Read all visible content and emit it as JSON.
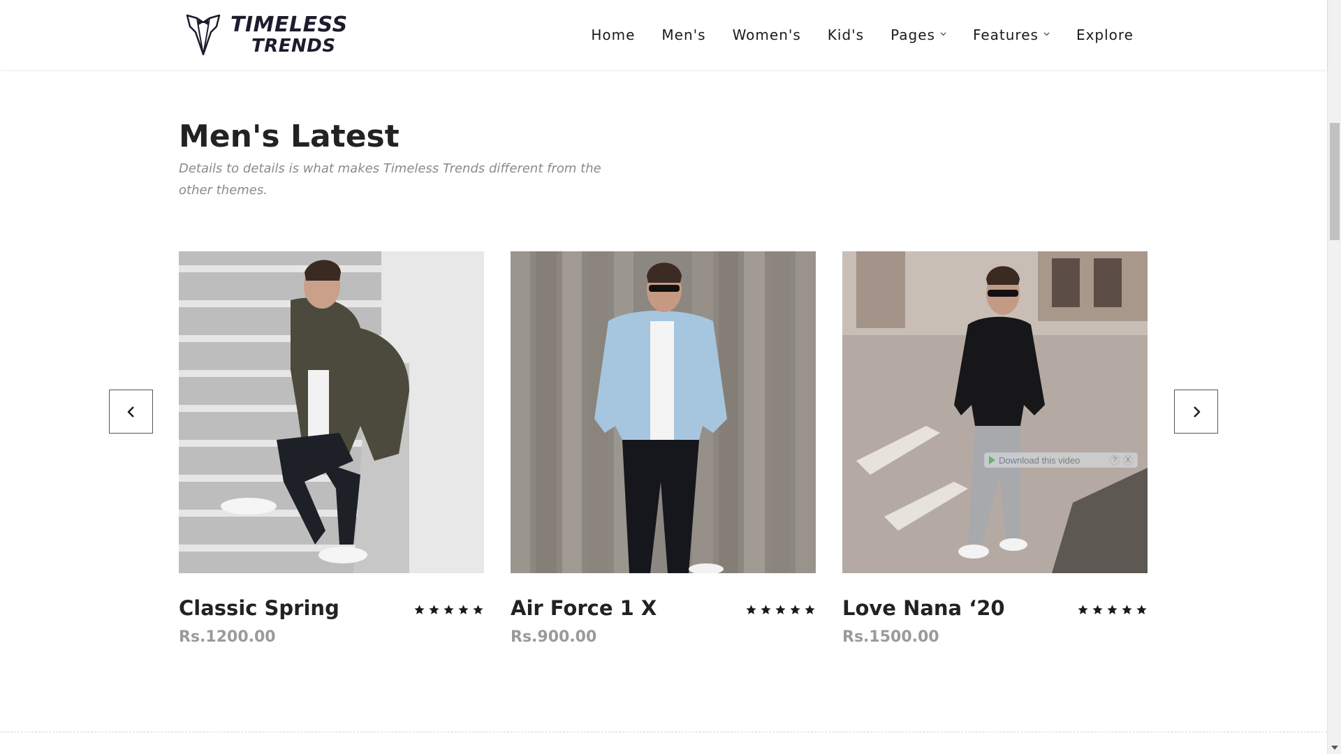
{
  "brand": {
    "line1": "TIMELESS",
    "line2": "TRENDS"
  },
  "nav": {
    "items": [
      {
        "label": "Home",
        "dropdown": false
      },
      {
        "label": "Men's",
        "dropdown": false
      },
      {
        "label": "Women's",
        "dropdown": false
      },
      {
        "label": "Kid's",
        "dropdown": false
      },
      {
        "label": "Pages",
        "dropdown": true
      },
      {
        "label": "Features",
        "dropdown": true
      },
      {
        "label": "Explore",
        "dropdown": false
      }
    ]
  },
  "section": {
    "title": "Men's Latest",
    "subtitle": "Details to details is what makes Timeless Trends different from the other themes."
  },
  "carousel": {
    "prev_icon": "chevron-left-icon",
    "next_icon": "chevron-right-icon"
  },
  "products": [
    {
      "name": "Classic Spring",
      "price": "Rs.1200.00",
      "rating": 5,
      "image": "man-on-stairs-camo-jacket"
    },
    {
      "name": "Air Force 1 X",
      "price": "Rs.900.00",
      "rating": 5,
      "image": "man-denim-jacket-wood-fence"
    },
    {
      "name": "Love Nana ‘20",
      "price": "Rs.1500.00",
      "rating": 5,
      "image": "man-black-sweater-street"
    }
  ],
  "overlay": {
    "label": "Download this video",
    "help": "?",
    "close": "X"
  },
  "colors": {
    "text_dark": "#222222",
    "text_muted": "#8a8a8a",
    "price": "#9a9a9a",
    "brand_dark": "#1c1c2c"
  }
}
